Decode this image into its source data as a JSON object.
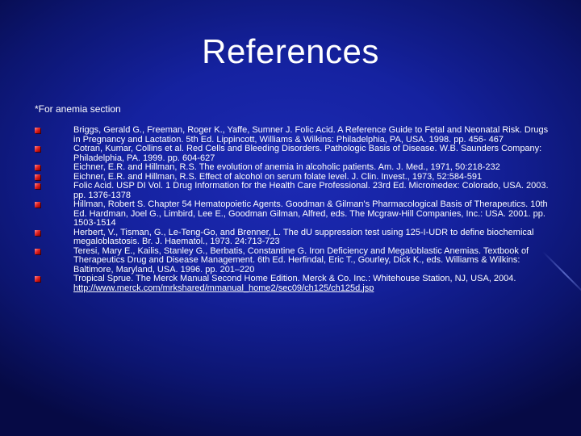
{
  "slide": {
    "title": "References",
    "subheading": "*For anemia section",
    "references": [
      "Briggs, Gerald G., Freeman, Roger K., Yaffe, Sumner J. Folic Acid. A Reference Guide to Fetal and Neonatal Risk. Drugs in Pregnancy and Lactation. 5th Ed. Lippincott, Williams & Wilkins: Philadelphia, PA, USA. 1998. pp. 456- 467",
      "Cotran, Kumar, Collins et al. Red Cells and Bleeding Disorders. Pathologic Basis of Disease. W.B. Saunders Company: Philadelphia, PA. 1999. pp. 604-627",
      "Eichner, E.R. and Hillman, R.S. The evolution of anemia in alcoholic patients. Am. J. Med., 1971, 50:218-232",
      "Eichner, E.R. and Hillman, R.S. Effect of alcohol on serum folate level. J. Clin. Invest., 1973, 52:584-591",
      "Folic Acid. USP DI Vol. 1 Drug Information for the Health Care Professional. 23rd Ed. Micromedex: Colorado, USA. 2003. pp. 1376-1378",
      "Hillman, Robert S. Chapter 54 Hematopoietic Agents. Goodman & Gilman's Pharmacological Basis of Therapeutics. 10th Ed. Hardman, Joel G., Limbird, Lee E., Goodman Gilman, Alfred, eds. The Mcgraw-Hill Companies, Inc.: USA. 2001. pp. 1503-1514",
      "Herbert, V., Tisman, G., Le-Teng-Go, and Brenner, L. The dU suppression test using 125-I-UDR to define biochemical megaloblastosis. Br. J. Haematol., 1973. 24:713-723",
      "Teresi, Mary E., Kailis, Stanley G., Berbatis, Constantine G. Iron Deficiency and Megaloblastic Anemias. Textbook of Therapeutics Drug and Disease Management. 6th Ed. Herfindal, Eric T., Gourley, Dick K., eds. Williams & Wilkins: Baltimore, Maryland, USA. 1996. pp. 201–220"
    ],
    "last_reference_text": "Tropical Sprue. The Merck Manual Second Home Edition. Merck & Co. Inc.: Whitehouse Station, NJ, USA, 2004.",
    "last_reference_link": "http://www.merck.com/mrkshared/mmanual_home2/sec09/ch125/ch125d.jsp"
  }
}
